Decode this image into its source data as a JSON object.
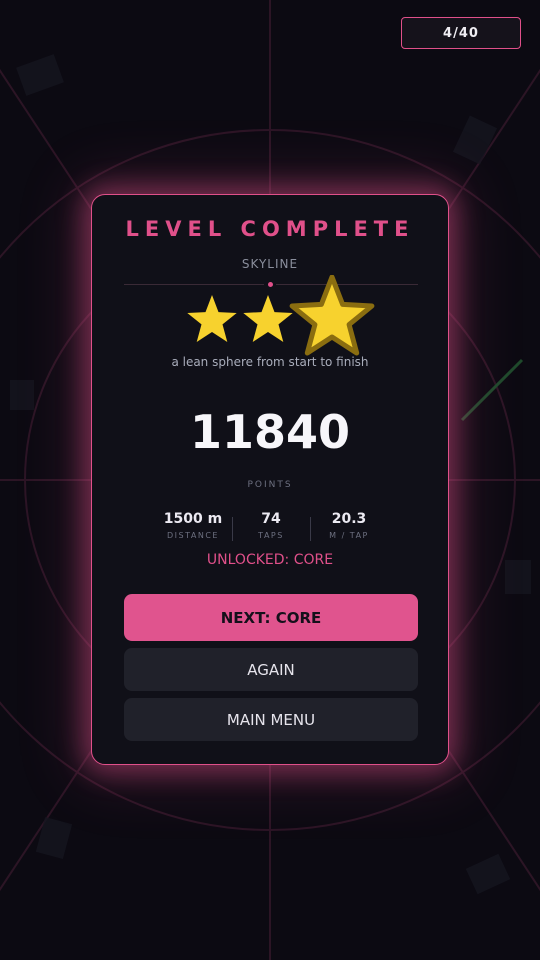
{
  "hud": {
    "level_counter": "4/40"
  },
  "results": {
    "title": "LEVEL COMPLETE",
    "level_name": "SKYLINE",
    "stars_earned": 2,
    "stars_total": 3,
    "tagline": "a lean sphere from start to finish",
    "score": "11840",
    "score_label": "POINTS",
    "stats": [
      {
        "value": "1500 m",
        "label": "DISTANCE"
      },
      {
        "value": "74",
        "label": "TAPS"
      },
      {
        "value": "20.3",
        "label": "M / TAP"
      }
    ],
    "unlocked": "UNLOCKED: CORE"
  },
  "buttons": {
    "next": "NEXT: CORE",
    "again": "AGAIN",
    "menu": "MAIN MENU"
  },
  "colors": {
    "accent": "#e0508a",
    "star_fill": "#f7d22e",
    "star_outline": "#8a6d10",
    "background": "#0c0a12",
    "card": "#101018"
  }
}
